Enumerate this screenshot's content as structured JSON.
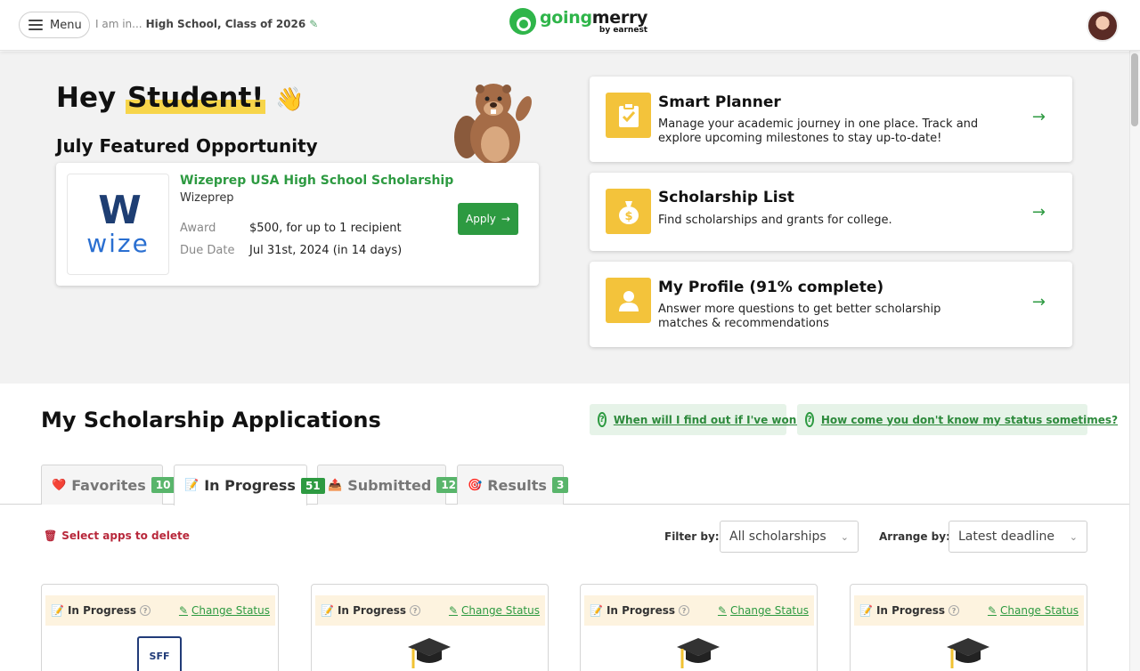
{
  "header": {
    "menu_label": "Menu",
    "iam_prefix": "I am in...",
    "iam_value": "High School, Class of 2026",
    "logo_going": "going",
    "logo_merry": "merry",
    "logo_sub": "by earnest"
  },
  "hero": {
    "greeting_prefix": "Hey",
    "greeting_name": "Student!",
    "greeting_emoji": "👋",
    "featured_title": "July Featured Opportunity",
    "opportunity": {
      "logo_mark": "W",
      "logo_word": "wize",
      "title": "Wizeprep USA High School Scholarship",
      "org": "Wizeprep",
      "award_label": "Award",
      "award_value": "$500, for up to 1 recipient",
      "due_label": "Due Date",
      "due_value": "Jul 31st, 2024 (in 14 days)",
      "apply_label": "Apply"
    },
    "cards": [
      {
        "title": "Smart Planner",
        "desc": "Manage your academic journey in one place. Track and explore upcoming milestones to stay up-to-date!",
        "icon": "clipboard-check-icon"
      },
      {
        "title": "Scholarship List",
        "desc": "Find scholarships and grants for college.",
        "icon": "money-bag-icon"
      },
      {
        "title": "My Profile (91% complete)",
        "desc": "Answer more questions to get better scholarship matches & recommendations",
        "icon": "user-icon"
      }
    ]
  },
  "applications": {
    "title": "My Scholarship Applications",
    "faq1": "When will I find out if I've won?",
    "faq2": "How come you don't know my status sometimes?",
    "tabs": [
      {
        "label": "Favorites",
        "count": "10",
        "emoji": "❤️"
      },
      {
        "label": "In Progress",
        "count": "51",
        "emoji": "📝"
      },
      {
        "label": "Submitted",
        "count": "12",
        "emoji": "📤"
      },
      {
        "label": "Results",
        "count": "3",
        "emoji": "🎯"
      }
    ],
    "delete_label": "Select apps to delete",
    "filter_label": "Filter by:",
    "filter_value": "All scholarships",
    "arrange_label": "Arrange by:",
    "arrange_value": "Latest deadline",
    "cards": [
      {
        "status": "In Progress",
        "change": "Change Status",
        "image": "SFF"
      },
      {
        "status": "In Progress",
        "change": "Change Status",
        "image": "graduation-cap"
      },
      {
        "status": "In Progress",
        "change": "Change Status",
        "image": "graduation-cap"
      },
      {
        "status": "In Progress",
        "change": "Change Status",
        "image": "graduation-cap"
      }
    ]
  },
  "colors": {
    "brand_green": "#2d9a41",
    "accent_yellow": "#f3c33b",
    "delete_red": "#b8283b"
  }
}
